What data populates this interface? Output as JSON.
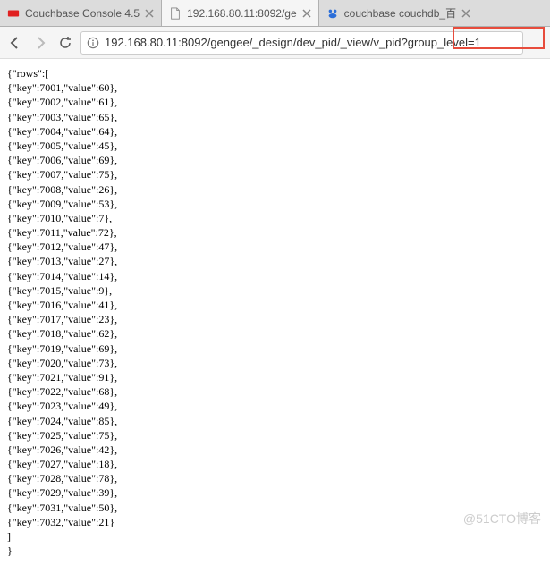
{
  "tabs": [
    {
      "title": "Couchbase Console 4.5",
      "iconColor": "#e02020",
      "active": false
    },
    {
      "title": "192.168.80.11:8092/ge",
      "iconColor": "#888",
      "active": true
    },
    {
      "title": "couchbase couchdb_百",
      "iconColor": "#2b6ed9",
      "active": false
    }
  ],
  "url": "192.168.80.11:8092/gengee/_design/dev_pid/_view/v_pid?group_level=1",
  "rows_header": "{\"rows\":[",
  "rows": [
    {
      "key": 7001,
      "value": 60
    },
    {
      "key": 7002,
      "value": 61
    },
    {
      "key": 7003,
      "value": 65
    },
    {
      "key": 7004,
      "value": 64
    },
    {
      "key": 7005,
      "value": 45
    },
    {
      "key": 7006,
      "value": 69
    },
    {
      "key": 7007,
      "value": 75
    },
    {
      "key": 7008,
      "value": 26
    },
    {
      "key": 7009,
      "value": 53
    },
    {
      "key": 7010,
      "value": 7
    },
    {
      "key": 7011,
      "value": 72
    },
    {
      "key": 7012,
      "value": 47
    },
    {
      "key": 7013,
      "value": 27
    },
    {
      "key": 7014,
      "value": 14
    },
    {
      "key": 7015,
      "value": 9
    },
    {
      "key": 7016,
      "value": 41
    },
    {
      "key": 7017,
      "value": 23
    },
    {
      "key": 7018,
      "value": 62
    },
    {
      "key": 7019,
      "value": 69
    },
    {
      "key": 7020,
      "value": 73
    },
    {
      "key": 7021,
      "value": 91
    },
    {
      "key": 7022,
      "value": 68
    },
    {
      "key": 7023,
      "value": 49
    },
    {
      "key": 7024,
      "value": 85
    },
    {
      "key": 7025,
      "value": 75
    },
    {
      "key": 7026,
      "value": 42
    },
    {
      "key": 7027,
      "value": 18
    },
    {
      "key": 7028,
      "value": 78
    },
    {
      "key": 7029,
      "value": 39
    },
    {
      "key": 7031,
      "value": 50
    },
    {
      "key": 7032,
      "value": 21
    }
  ],
  "rows_footer1": "]",
  "rows_footer2": "}",
  "watermark": "@51CTO博客"
}
